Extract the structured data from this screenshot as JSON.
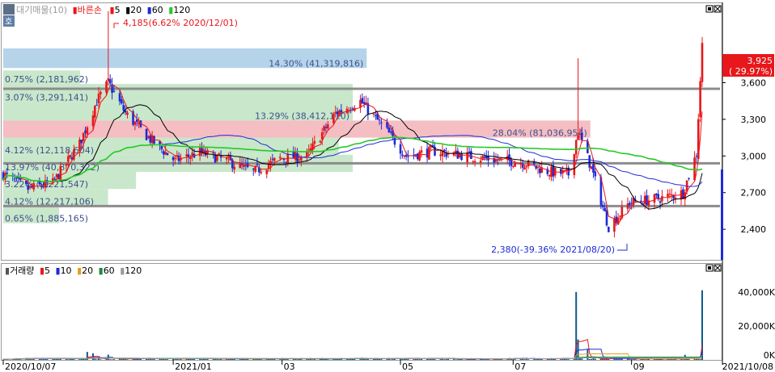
{
  "legend_top": {
    "prefix": "대기매물(10)",
    "title": "바른손",
    "ma": [
      {
        "label": "5",
        "color": "#e8171b"
      },
      {
        "label": "20",
        "color": "#000000"
      },
      {
        "label": "60",
        "color": "#1e2bd6"
      },
      {
        "label": "120",
        "color": "#27c827"
      }
    ]
  },
  "legend_bottom": {
    "title": "거래량",
    "ma": [
      {
        "label": "5",
        "color": "#e8171b"
      },
      {
        "label": "10",
        "color": "#1e2bd6"
      },
      {
        "label": "20",
        "color": "#e0a020"
      },
      {
        "label": "60",
        "color": "#1a8a3a"
      },
      {
        "label": "120",
        "color": "#9a9a9a"
      }
    ]
  },
  "annotations": {
    "high": "4,185(6.62% 2020/12/01)",
    "low": "2,380(-39.36% 2021/08/20)",
    "last_price": "3,925",
    "last_change": "( 29.97%)"
  },
  "colors": {
    "up": "#e8171b",
    "down": "#1e2bd6",
    "volume_up": "#0f5a8c",
    "volume_down": "#0f5a8c"
  },
  "chart_data": [
    {
      "type": "candlestick",
      "title": "바른손",
      "ylim": [
        2150,
        4250
      ],
      "y_ticks": [
        "3,600",
        "3,300",
        "3,000",
        "2,700",
        "2,400"
      ],
      "y_tick_values": [
        3600,
        3300,
        3000,
        2700,
        2400
      ],
      "x_ticks": [
        "2020/10/07",
        "2021/01",
        "03",
        "05",
        "07",
        "09",
        "2021/10/08"
      ],
      "x_tick_values": [
        "2020-10-07",
        "2021-01-04",
        "2021-03-02",
        "2021-05-03",
        "2021-07-01",
        "2021-09-01",
        "2021-10-08"
      ],
      "horizontal_lines": [
        3550,
        2940,
        2590
      ],
      "supply_zones": [
        {
          "label": "14.30% (41,319,816)",
          "y0": 3720,
          "y1": 3880,
          "color": "#a8cde6"
        },
        {
          "label": "28.04% (81,036,954)",
          "y0": 3150,
          "y1": 3290,
          "color": "#f2b3b8"
        },
        {
          "label": "13.29% (38,412,110)",
          "y0": 3290,
          "y1": 3440,
          "color": "#bfe3c1"
        },
        {
          "label": "0.75% (2,181,962)",
          "y0": 3590,
          "y1": 3700,
          "color": "#bfe3c1"
        },
        {
          "label": "3.07% (3,291,141)",
          "y0": 3440,
          "y1": 3590,
          "color": "#bfe3c1"
        },
        {
          "label": "4.12% (12,118,604)",
          "y0": 3010,
          "y1": 3150,
          "color": "#bfe3c1"
        },
        {
          "label": "13.97% (40,870,322)",
          "y0": 2870,
          "y1": 3010,
          "color": "#bfe3c1"
        },
        {
          "label": "3.22% (9,221,547)",
          "y0": 2730,
          "y1": 2870,
          "color": "#bfe3c1"
        },
        {
          "label": "4.12% (12,217,106)",
          "y0": 2590,
          "y1": 2730,
          "color": "#bfe3c1"
        },
        {
          "label": "0.65% (1,885,165)",
          "y0": 2450,
          "y1": 2590,
          "color": "#bfe3c1"
        }
      ],
      "series": [
        {
          "name": "5",
          "color": "#e8171b"
        },
        {
          "name": "20",
          "color": "#000000"
        },
        {
          "name": "60",
          "color": "#1e2bd6"
        },
        {
          "name": "120",
          "color": "#27c827"
        }
      ],
      "high": {
        "date": "2020-12-01",
        "value": 4185
      },
      "low": {
        "date": "2021-08-20",
        "value": 2380
      },
      "last": {
        "date": "2021-10-08",
        "value": 3925
      }
    },
    {
      "type": "bar",
      "title": "거래량",
      "ylim": [
        0,
        48000
      ],
      "y_ticks": [
        "40,000K",
        "20,000K",
        "0K"
      ],
      "y_tick_values": [
        40000,
        20000,
        0
      ],
      "spikes": [
        {
          "date": "2020-11-20",
          "value": 4700
        },
        {
          "date": "2020-11-23",
          "value": 3900
        },
        {
          "date": "2020-12-01",
          "value": 3100
        },
        {
          "date": "2021-08-03",
          "value": 40000
        },
        {
          "date": "2021-08-04",
          "value": 12000
        },
        {
          "date": "2021-08-09",
          "value": 6000
        },
        {
          "date": "2021-09-29",
          "value": 3000
        },
        {
          "date": "2021-10-08",
          "value": 41000
        }
      ]
    }
  ]
}
